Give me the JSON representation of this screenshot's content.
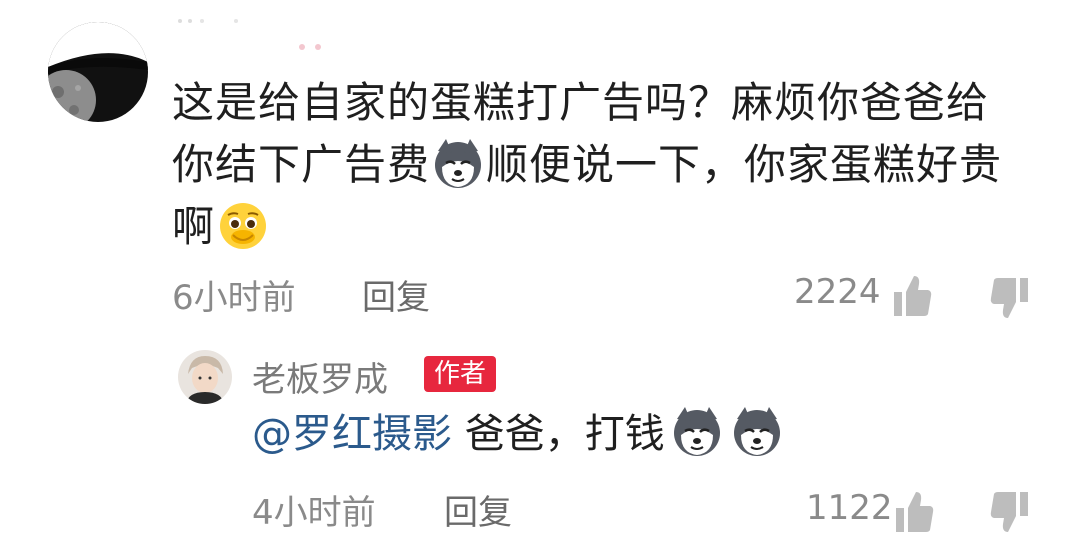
{
  "comment": {
    "line1": "这是给自家的蛋糕打广告吗？麻烦你爸爸给",
    "line2a": "你结下广告费",
    "line2b": "顺便说一下，你家蛋糕好贵",
    "line3": "啊",
    "time": "6小时前",
    "reply_label": "回复",
    "likes": "2224"
  },
  "reply": {
    "author": "老板罗成",
    "badge": "作者",
    "mention": "@罗红摄影",
    "text": " 爸爸，打钱",
    "time": "4小时前",
    "reply_label": "回复",
    "likes": "1122"
  },
  "icons": {
    "like": "thumbs-up-icon",
    "dislike": "thumbs-down-icon",
    "emoji_dog": "doge-emoji",
    "emoji_pleading": "pleading-face-emoji"
  }
}
